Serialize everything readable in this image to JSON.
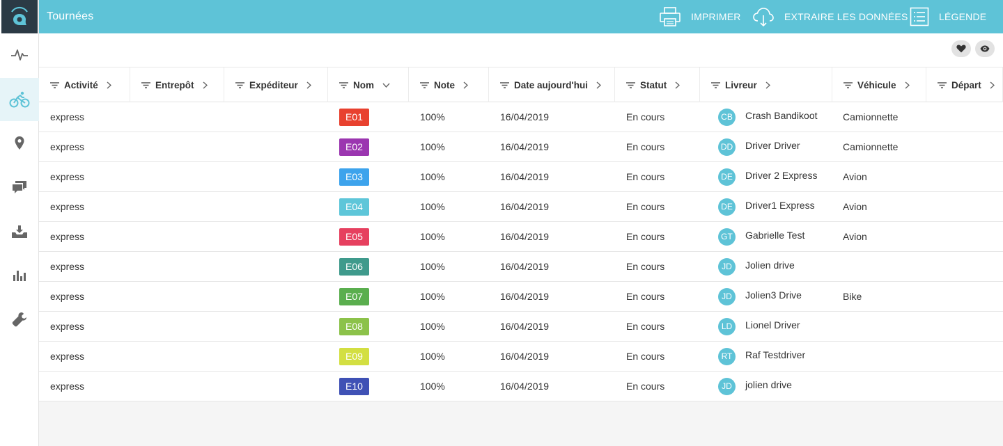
{
  "header": {
    "title": "Tournées",
    "actions": [
      {
        "label": "IMPRIMER",
        "icon": "printer-icon"
      },
      {
        "label": "EXTRAIRE LES DONNÉES",
        "icon": "cloud-download-icon"
      },
      {
        "label": "LÉGENDE",
        "icon": "list-icon"
      }
    ]
  },
  "sidebar": {
    "items": [
      {
        "name": "activity-icon"
      },
      {
        "name": "bike-icon",
        "active": true
      },
      {
        "name": "location-pin-icon"
      },
      {
        "name": "chat-icon"
      },
      {
        "name": "inbox-download-icon"
      },
      {
        "name": "bar-chart-icon"
      },
      {
        "name": "wrench-icon"
      }
    ]
  },
  "toolbar": {
    "buttons": [
      "heart-icon",
      "eye-icon"
    ]
  },
  "columns": [
    "Activité",
    "Entrepôt",
    "Expéditeur",
    "Nom",
    "Note",
    "Date aujourd'hui",
    "Statut",
    "Livreur",
    "Véhicule",
    "Départ"
  ],
  "rows": [
    {
      "activite": "express",
      "nom": "E01",
      "color": "#e8412f",
      "note": "100%",
      "date": "16/04/2019",
      "statut": "En cours",
      "initials": "CB",
      "livreur": "Crash Bandikoot",
      "vehicule": "Camionnette"
    },
    {
      "activite": "express",
      "nom": "E02",
      "color": "#9b36b0",
      "note": "100%",
      "date": "16/04/2019",
      "statut": "En cours",
      "initials": "DD",
      "livreur": "Driver Driver",
      "vehicule": "Camionnette"
    },
    {
      "activite": "express",
      "nom": "E03",
      "color": "#3da3ec",
      "note": "100%",
      "date": "16/04/2019",
      "statut": "En cours",
      "initials": "DE",
      "livreur": "Driver 2 Express",
      "vehicule": "Avion"
    },
    {
      "activite": "express",
      "nom": "E04",
      "color": "#5ec6d9",
      "note": "100%",
      "date": "16/04/2019",
      "statut": "En cours",
      "initials": "DE",
      "livreur": "Driver1 Express",
      "vehicule": "Avion"
    },
    {
      "activite": "express",
      "nom": "E05",
      "color": "#e6405f",
      "note": "100%",
      "date": "16/04/2019",
      "statut": "En cours",
      "initials": "GT",
      "livreur": "Gabrielle Test",
      "vehicule": "Avion"
    },
    {
      "activite": "express",
      "nom": "E06",
      "color": "#3f9a8c",
      "note": "100%",
      "date": "16/04/2019",
      "statut": "En cours",
      "initials": "JD",
      "livreur": "Jolien drive",
      "vehicule": ""
    },
    {
      "activite": "express",
      "nom": "E07",
      "color": "#5aae4e",
      "note": "100%",
      "date": "16/04/2019",
      "statut": "En cours",
      "initials": "JD",
      "livreur": "Jolien3 Drive",
      "vehicule": "Bike"
    },
    {
      "activite": "express",
      "nom": "E08",
      "color": "#8cc24a",
      "note": "100%",
      "date": "16/04/2019",
      "statut": "En cours",
      "initials": "LD",
      "livreur": "Lionel Driver",
      "vehicule": ""
    },
    {
      "activite": "express",
      "nom": "E09",
      "color": "#d3df42",
      "note": "100%",
      "date": "16/04/2019",
      "statut": "En cours",
      "initials": "RT",
      "livreur": "Raf Testdriver",
      "vehicule": ""
    },
    {
      "activite": "express",
      "nom": "E10",
      "color": "#3f51b5",
      "note": "100%",
      "date": "16/04/2019",
      "statut": "En cours",
      "initials": "JD",
      "livreur": "jolien drive",
      "vehicule": ""
    }
  ],
  "colors": {
    "accent": "#5ec3d7",
    "sidebar_dark": "#2b3a45"
  }
}
